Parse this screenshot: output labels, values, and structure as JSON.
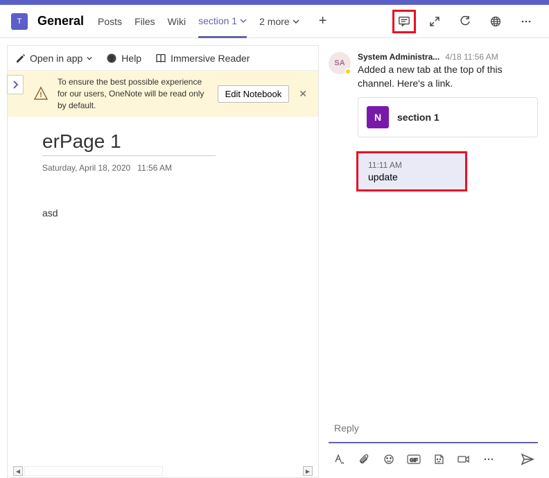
{
  "team_letter": "T",
  "channel": "General",
  "tabs": {
    "posts": "Posts",
    "files": "Files",
    "wiki": "Wiki",
    "section1": "section 1",
    "more": "2 more"
  },
  "onenote_toolbar": {
    "open_in_app": "Open in app",
    "help": "Help",
    "immersive": "Immersive Reader"
  },
  "warning": {
    "text": "To ensure the best possible experience for our users, OneNote will be read only by default.",
    "edit_btn": "Edit Notebook"
  },
  "page": {
    "title": "erPage 1",
    "date": "Saturday, April 18, 2020",
    "time": "11:56 AM",
    "content": "asd"
  },
  "chat": {
    "avatar_initials": "SA",
    "author": "System Administra...",
    "timestamp": "4/18 11:56 AM",
    "text": "Added a new tab at the top of this channel. Here's a link.",
    "link_icon_letter": "N",
    "link_title": "section 1",
    "reply_time": "11:11 AM",
    "reply_text": "update"
  },
  "reply": {
    "placeholder": "Reply"
  }
}
